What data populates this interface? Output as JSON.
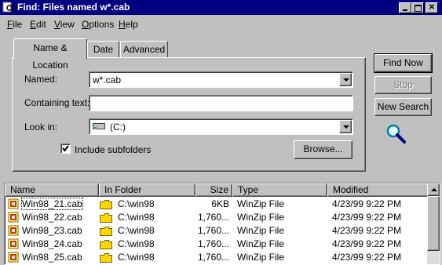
{
  "window": {
    "title": "Find: Files named w*.cab"
  },
  "menu": [
    {
      "label": "File",
      "key": "F",
      "rest": "ile"
    },
    {
      "label": "Edit",
      "key": "E",
      "rest": "dit"
    },
    {
      "label": "View",
      "key": "V",
      "rest": "iew"
    },
    {
      "label": "Options",
      "key": "O",
      "rest": "ptions"
    },
    {
      "label": "Help",
      "key": "H",
      "rest": "elp"
    }
  ],
  "tabs": [
    "Name & Location",
    "Date",
    "Advanced"
  ],
  "form": {
    "named_label": "Named:",
    "named_value": "w*.cab",
    "containing_label": "Containing text:",
    "containing_value": "",
    "lookin_label": "Look in:",
    "lookin_value": "(C:)",
    "include_subfolders_label": "Include subfolders",
    "include_subfolders_checked": true,
    "browse_label": "Browse..."
  },
  "buttons": {
    "find_now": "Find Now",
    "stop": "Stop",
    "new_search": "New Search"
  },
  "list": {
    "columns": [
      "Name",
      "In Folder",
      "Size",
      "Type",
      "Modified"
    ],
    "rows": [
      {
        "name": "Win98_21.cab",
        "folder": "C:\\win98",
        "size": "6KB",
        "type": "WinZip File",
        "modified": "4/23/99 9:22 PM"
      },
      {
        "name": "Win98_22.cab",
        "folder": "C:\\win98",
        "size": "1,760...",
        "type": "WinZip File",
        "modified": "4/23/99 9:22 PM"
      },
      {
        "name": "Win98_23.cab",
        "folder": "C:\\win98",
        "size": "1,760...",
        "type": "WinZip File",
        "modified": "4/23/99 9:22 PM"
      },
      {
        "name": "Win98_24.cab",
        "folder": "C:\\win98",
        "size": "1,760...",
        "type": "WinZip File",
        "modified": "4/23/99 9:22 PM"
      },
      {
        "name": "Win98_25.cab",
        "folder": "C:\\win98",
        "size": "1,760...",
        "type": "WinZip File",
        "modified": "4/23/99 9:22 PM"
      }
    ]
  },
  "colors": {
    "titlebar": "#000080",
    "face": "#c0c0c0",
    "folder": "#ffd800"
  },
  "icons": [
    "find-window-icon",
    "minimize-icon",
    "maximize-icon",
    "close-icon",
    "drive-icon",
    "magnifier-icon",
    "winzip-file-icon",
    "folder-icon",
    "dropdown-arrow-icon",
    "scroll-up-icon"
  ]
}
